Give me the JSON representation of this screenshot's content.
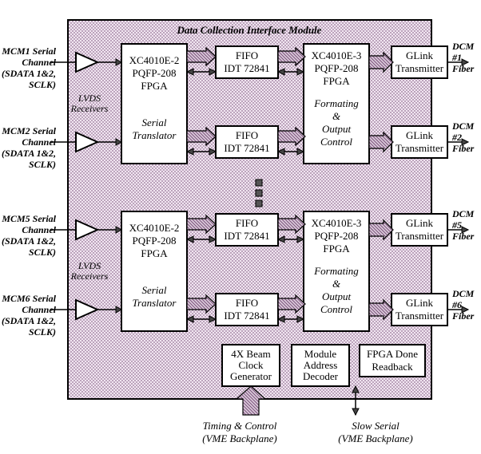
{
  "title": "Data Collection Interface Module",
  "left_inputs": [
    {
      "l1": "MCM1 Serial",
      "l2": "Channel",
      "l3": "(SDATA 1&2,",
      "l4": "SCLK)"
    },
    {
      "l1": "MCM2 Serial",
      "l2": "Channel",
      "l3": "(SDATA 1&2,",
      "l4": "SCLK)"
    },
    {
      "l1": "MCM5 Serial",
      "l2": "Channel",
      "l3": "(SDATA 1&2,",
      "l4": "SCLK)"
    },
    {
      "l1": "MCM6 Serial",
      "l2": "Channel",
      "l3": "(SDATA 1&2,",
      "l4": "SCLK)"
    }
  ],
  "right_outputs": [
    {
      "l1": "DCM",
      "l2": "#1",
      "l3": "Fiber"
    },
    {
      "l1": "DCM",
      "l2": "#2",
      "l3": "Fiber"
    },
    {
      "l1": "DCM",
      "l2": "#5",
      "l3": "Fiber"
    },
    {
      "l1": "DCM",
      "l2": "#6",
      "l3": "Fiber"
    }
  ],
  "lvds": "LVDS\nReceivers",
  "xc_input": {
    "l1": "XC4010E-2",
    "l2": "PQFP-208",
    "l3": "FPGA",
    "sub": "Serial\nTranslator"
  },
  "fifo": {
    "l1": "FIFO",
    "l2": "IDT 72841"
  },
  "xc_output": {
    "l1": "XC4010E-3",
    "l2": "PQFP-208",
    "l3": "FPGA",
    "sub": "Formating\n&\nOutput\nControl"
  },
  "glink": {
    "l1": "GLink",
    "l2": "Transmitter"
  },
  "bottom_blocks": {
    "clk": "4X Beam\nClock\nGenerator",
    "addr": "Module\nAddress\nDecoder",
    "fpga": "FPGA Done\nReadback"
  },
  "bottom_labels": {
    "timing": "Timing & Control\n(VME Backplane)",
    "slow": "Slow Serial\n(VME Backplane)"
  }
}
